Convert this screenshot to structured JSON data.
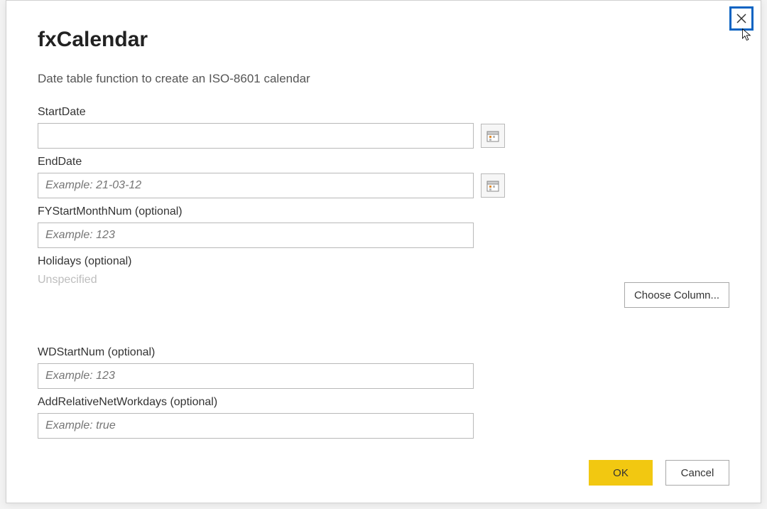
{
  "dialog": {
    "title": "fxCalendar",
    "subtitle": "Date table function to create an ISO-8601 calendar"
  },
  "fields": {
    "startDate": {
      "label": "StartDate",
      "value": "",
      "placeholder": ""
    },
    "endDate": {
      "label": "EndDate",
      "value": "",
      "placeholder": "Example: 21-03-12"
    },
    "fyStartMonthNum": {
      "label": "FYStartMonthNum (optional)",
      "value": "",
      "placeholder": "Example: 123"
    },
    "holidays": {
      "label": "Holidays (optional)",
      "unspecified": "Unspecified",
      "chooseColumn": "Choose Column..."
    },
    "wdStartNum": {
      "label": "WDStartNum (optional)",
      "value": "",
      "placeholder": "Example: 123"
    },
    "addRelativeNetWorkdays": {
      "label": "AddRelativeNetWorkdays (optional)",
      "value": "",
      "placeholder": "Example: true"
    }
  },
  "buttons": {
    "ok": "OK",
    "cancel": "Cancel"
  }
}
